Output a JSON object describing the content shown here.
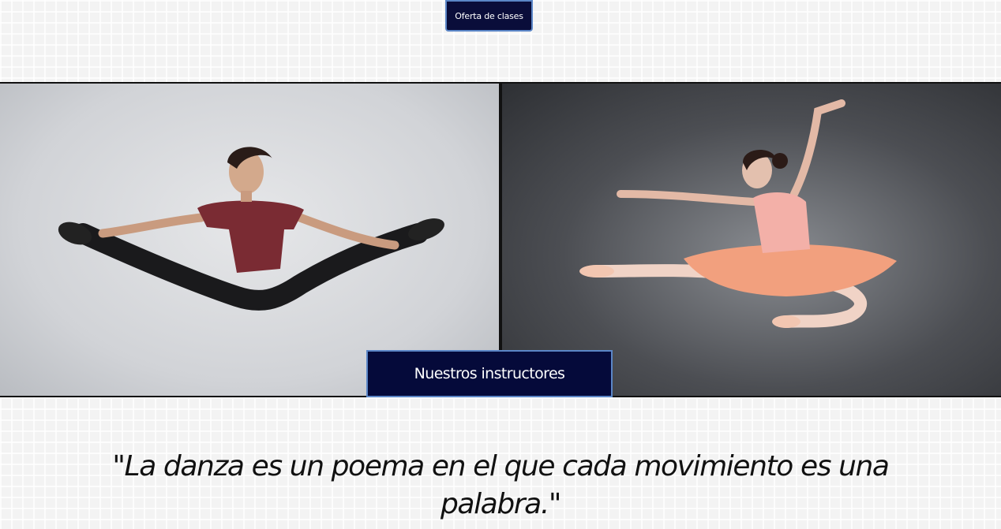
{
  "nav": {
    "offer_button": "Oferta de clases"
  },
  "banner": {
    "left_photo": {
      "alt": "male-dancer-split-jump"
    },
    "right_photo": {
      "alt": "ballerina-leap"
    },
    "instructors_button": "Nuestros instructores"
  },
  "quote": {
    "text": "\"La danza es un poema en el que cada movimiento es una palabra.\""
  },
  "colors": {
    "button_bg": "#0a0d3a",
    "button_border": "#5b86c7",
    "page_bg": "#f3f3f3"
  }
}
